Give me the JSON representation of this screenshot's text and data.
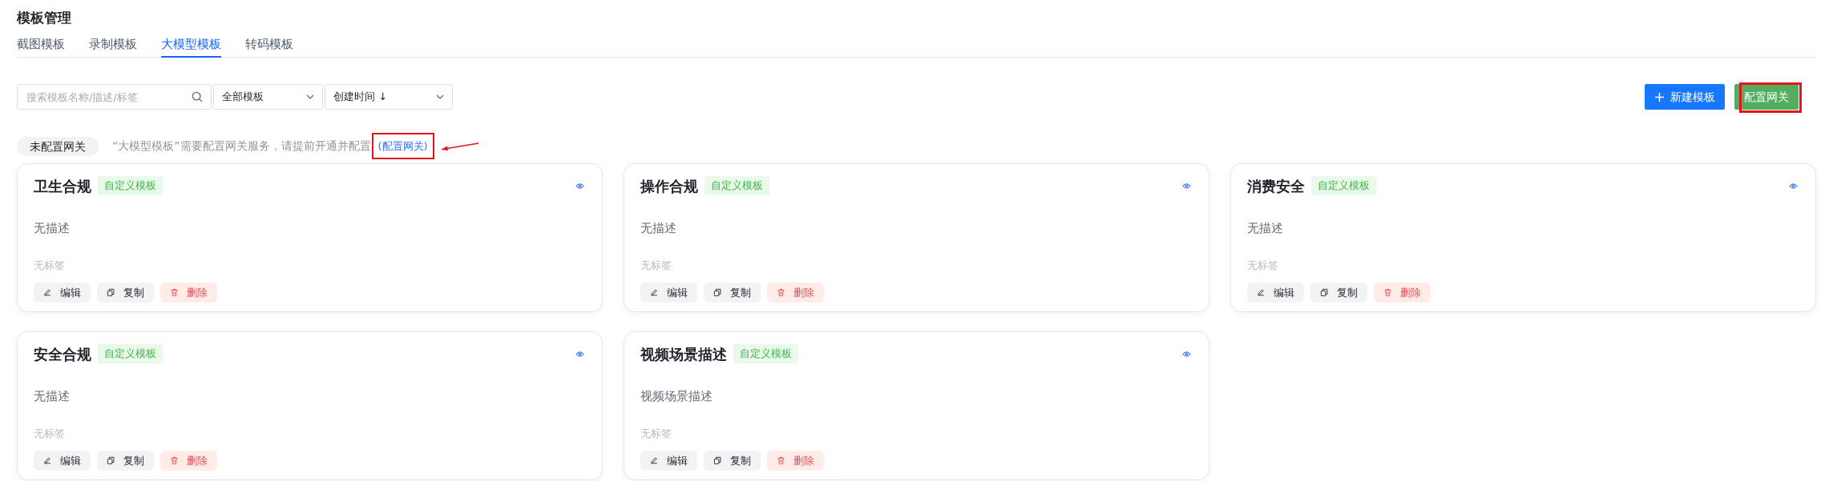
{
  "page_title": "模板管理",
  "tabs": [
    {
      "label": "截图模板",
      "selected": false
    },
    {
      "label": "录制模板",
      "selected": false
    },
    {
      "label": "大模型模板",
      "selected": true
    },
    {
      "label": "转码模板",
      "selected": false
    }
  ],
  "search": {
    "placeholder": "搜索模板名称/描述/标签"
  },
  "filters": [
    {
      "value": "全部模板"
    },
    {
      "value": "创建时间 ↓"
    }
  ],
  "actions": [
    {
      "kind": "primary",
      "label": "新建模板",
      "highlighted": false
    },
    {
      "kind": "success",
      "label": "配置网关",
      "highlighted": true
    }
  ],
  "notice": {
    "badge": "未配置网关",
    "text": "“大模型模板”需要配置网关服务，请提前开通并配置",
    "link": "(配置网关)",
    "highlighted": true
  },
  "cards": [
    {
      "title": "卫生合规",
      "tag": "自定义模板",
      "description": "无描述",
      "tags_text": "无标签",
      "buttons": [
        {
          "kind": "edit",
          "label": "编辑"
        },
        {
          "kind": "copy",
          "label": "复制"
        },
        {
          "kind": "delete",
          "label": "删除"
        }
      ]
    },
    {
      "title": "操作合规",
      "tag": "自定义模板",
      "description": "无描述",
      "tags_text": "无标签",
      "buttons": [
        {
          "kind": "edit",
          "label": "编辑"
        },
        {
          "kind": "copy",
          "label": "复制"
        },
        {
          "kind": "delete",
          "label": "删除"
        }
      ]
    },
    {
      "title": "消费安全",
      "tag": "自定义模板",
      "description": "无描述",
      "tags_text": "无标签",
      "buttons": [
        {
          "kind": "edit",
          "label": "编辑"
        },
        {
          "kind": "copy",
          "label": "复制"
        },
        {
          "kind": "delete",
          "label": "删除"
        }
      ]
    },
    {
      "title": "安全合规",
      "tag": "自定义模板",
      "description": "无描述",
      "tags_text": "无标签",
      "buttons": [
        {
          "kind": "edit",
          "label": "编辑"
        },
        {
          "kind": "copy",
          "label": "复制"
        },
        {
          "kind": "delete",
          "label": "删除"
        }
      ]
    },
    {
      "title": "视频场景描述",
      "tag": "自定义模板",
      "description": "视频场景描述",
      "tags_text": "无标签",
      "buttons": [
        {
          "kind": "edit",
          "label": "编辑"
        },
        {
          "kind": "copy",
          "label": "复制"
        },
        {
          "kind": "delete",
          "label": "删除"
        }
      ]
    }
  ]
}
